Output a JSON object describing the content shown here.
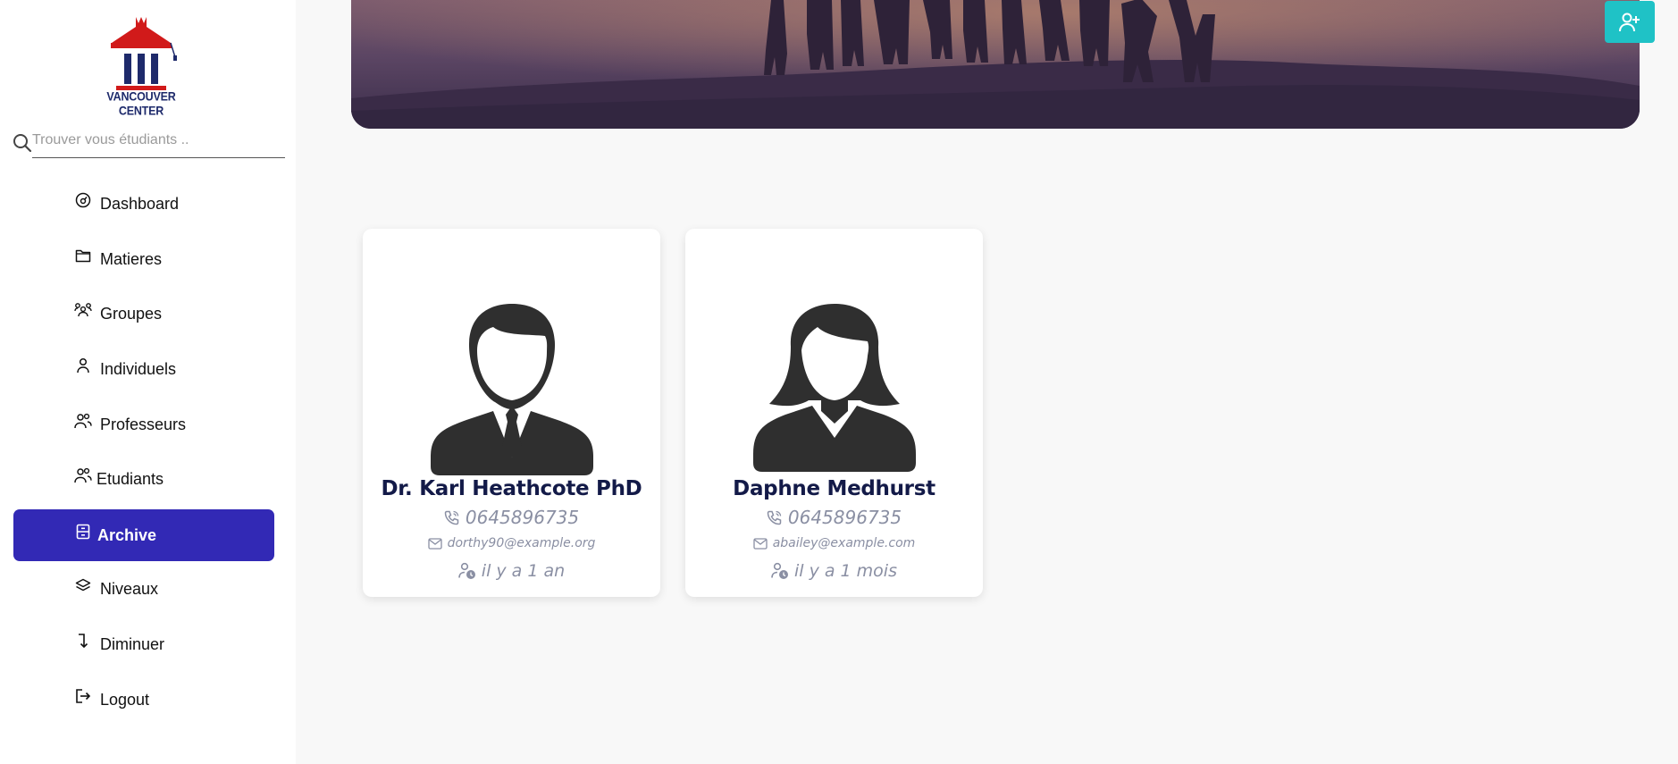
{
  "brand": {
    "name": "VANCOUVER CENTER",
    "colors": {
      "red": "#d11a1a",
      "navy": "#1e2a6b"
    }
  },
  "search": {
    "placeholder": "Trouver vous étudiants ..",
    "icon": "search-icon"
  },
  "sidebar": {
    "items": [
      {
        "label": "Dashboard",
        "icon": "dashboard-icon",
        "active": false
      },
      {
        "label": "Matieres",
        "icon": "folder-icon",
        "active": false
      },
      {
        "label": "Groupes",
        "icon": "groups-icon",
        "active": false
      },
      {
        "label": "Individuels",
        "icon": "person-icon",
        "active": false
      },
      {
        "label": "Professeurs",
        "icon": "users-icon",
        "active": false
      },
      {
        "label": "Etudiants",
        "icon": "users-icon",
        "active": false
      },
      {
        "label": "Archive",
        "icon": "archive-icon",
        "active": true
      },
      {
        "label": "Niveaux",
        "icon": "layers-icon",
        "active": false
      },
      {
        "label": "Diminuer",
        "icon": "turn-down-icon",
        "active": false
      },
      {
        "label": "Logout",
        "icon": "logout-icon",
        "active": false
      }
    ],
    "active_color": "#3229b5"
  },
  "actions": {
    "add_user": {
      "icon": "add-user-icon",
      "color": "#1fc2c6"
    }
  },
  "cards": [
    {
      "name": "Dr. Karl Heathcote PhD",
      "phone": "0645896735",
      "email": "dorthy90@example.org",
      "since": "il y a 1 an",
      "avatar": "male-avatar-icon"
    },
    {
      "name": "Daphne Medhurst",
      "phone": "0645896735",
      "email": "abailey@example.com",
      "since": "il y a 1 mois",
      "avatar": "female-avatar-icon"
    }
  ]
}
